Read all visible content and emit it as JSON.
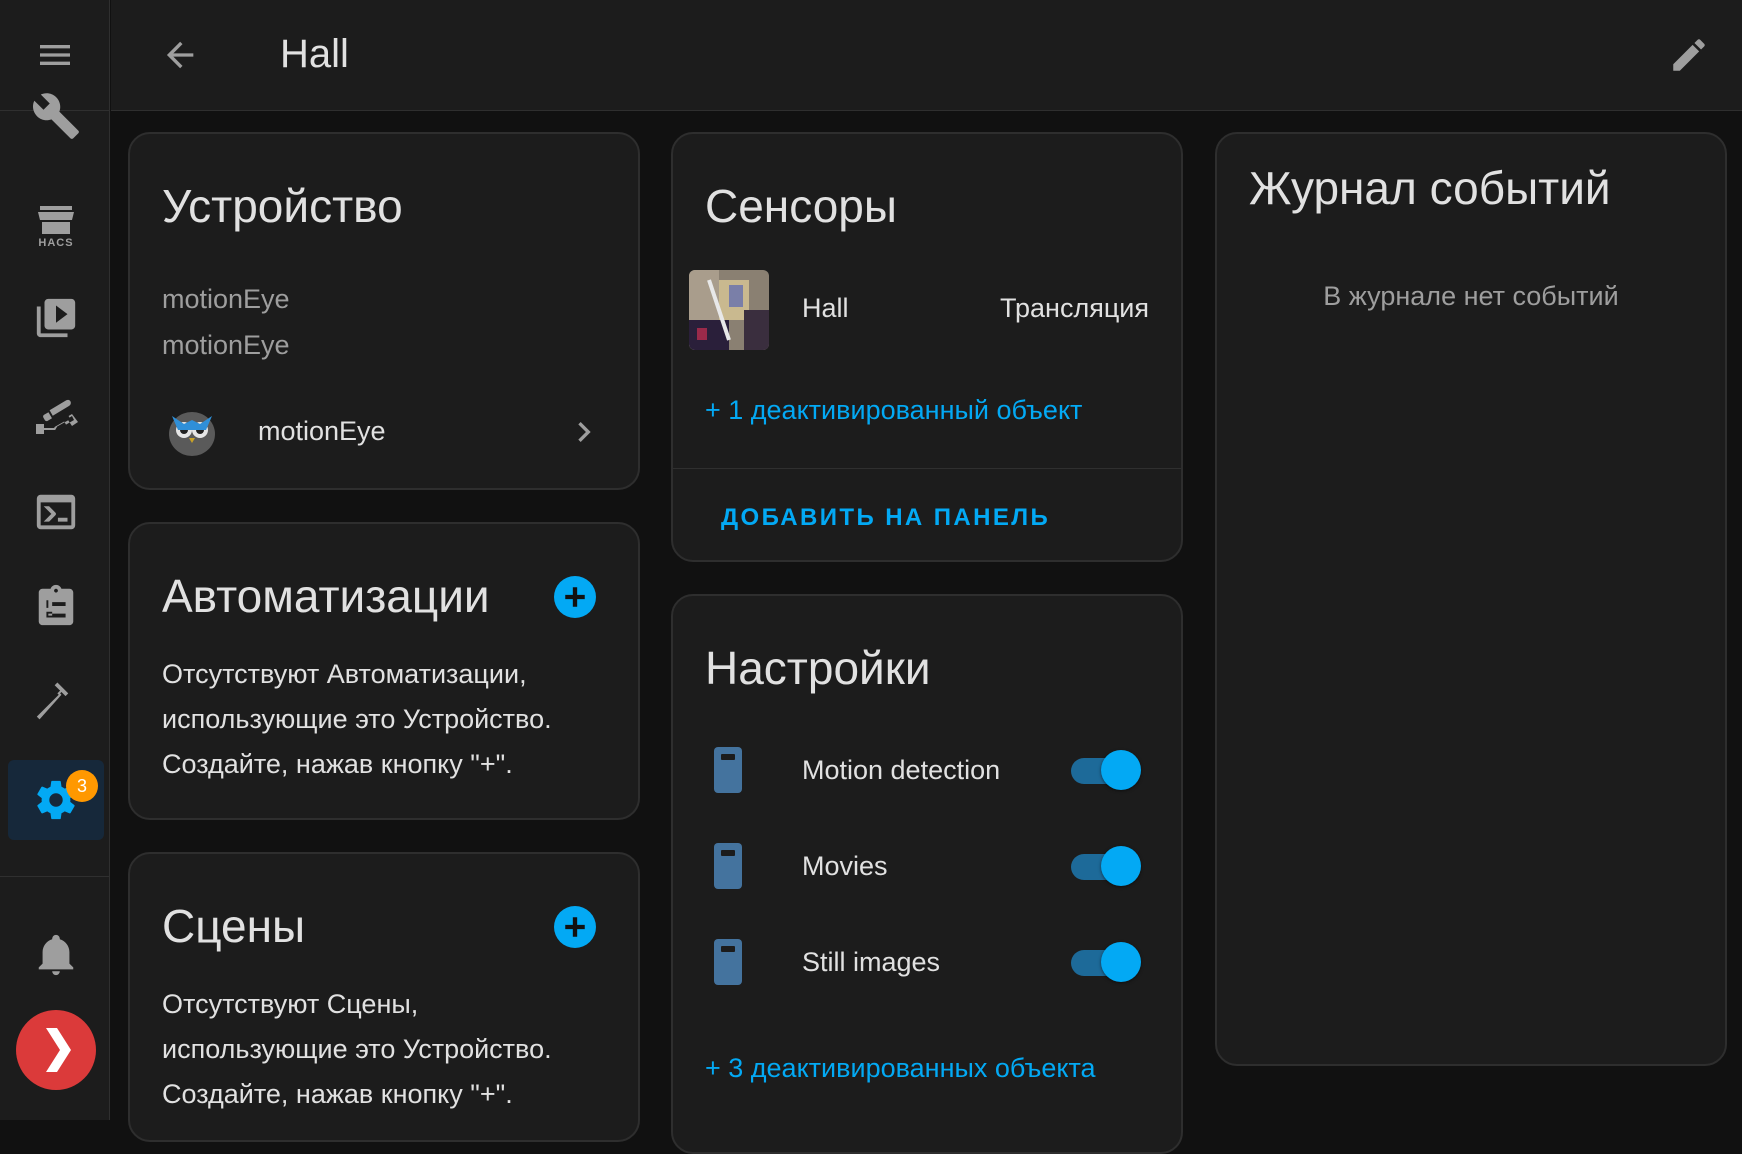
{
  "header": {
    "title": "Hall"
  },
  "sidebar": {
    "items": [
      {
        "icon": "wrench-icon"
      },
      {
        "icon": "hacs-icon",
        "label": "HACS"
      },
      {
        "icon": "media-icon"
      },
      {
        "icon": "cctv-icon"
      },
      {
        "icon": "terminal-icon"
      },
      {
        "icon": "clipboard-list-icon"
      },
      {
        "icon": "hammer-icon"
      },
      {
        "icon": "settings-icon",
        "badge": "3",
        "active": true
      },
      {
        "icon": "bell-icon"
      },
      {
        "icon": "plex-icon"
      }
    ],
    "accent_color": "#03a9f4",
    "badge_color": "#ff9800"
  },
  "device_card": {
    "title": "Устройство",
    "model": "motionEye",
    "manufacturer": "motionEye",
    "integration_label": "motionEye"
  },
  "automations_card": {
    "title": "Автоматизации",
    "empty_text_line1": "Отсутствуют Автоматизации,",
    "empty_text_line2": "использующие это Устройство.",
    "empty_text_line3": "Создайте, нажав кнопку \"+\"."
  },
  "scenes_card": {
    "title": "Сцены",
    "empty_text_line1": "Отсутствуют Сцены,",
    "empty_text_line2": "использующие это Устройство.",
    "empty_text_line3": "Создайте, нажав кнопку \"+\"."
  },
  "sensors_card": {
    "title": "Сенсоры",
    "entity_name": "Hall",
    "entity_state": "Трансляция",
    "disabled_link": "+ 1 деактивированный объект",
    "add_to_panel": "ДОБАВИТЬ НА ПАНЕЛЬ"
  },
  "settings_card": {
    "title": "Настройки",
    "items": [
      {
        "label": "Motion detection",
        "on": true
      },
      {
        "label": "Movies",
        "on": true
      },
      {
        "label": "Still images",
        "on": true
      }
    ],
    "disabled_link": "+ 3 деактивированных объекта"
  },
  "logbook_card": {
    "title": "Журнал событий",
    "empty_text": "В журнале нет событий"
  }
}
